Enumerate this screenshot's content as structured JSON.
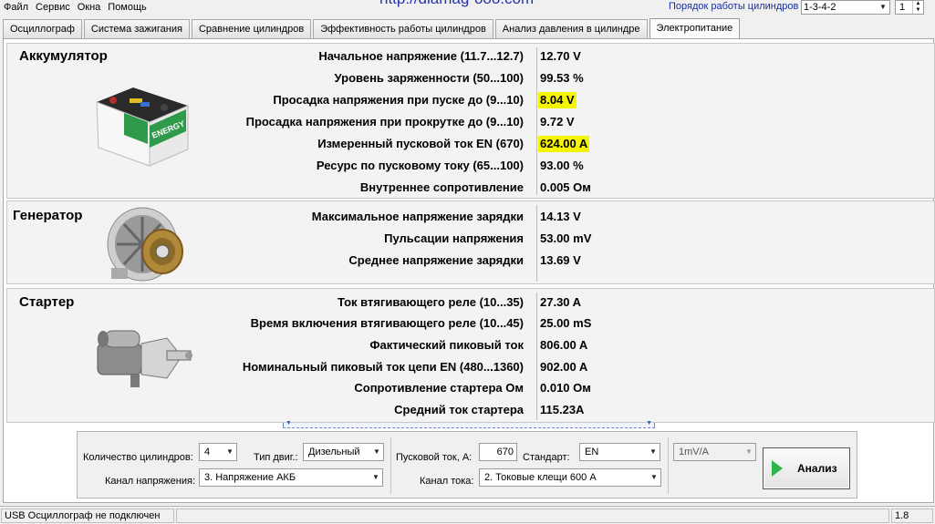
{
  "menu": [
    "Файл",
    "Сервис",
    "Окна",
    "Помощь"
  ],
  "url_text": "http://diamag-ooo.com",
  "cylinder_order": {
    "label": "Порядок работы цилиндров",
    "value": "1-3-4-2",
    "spin_value": "1"
  },
  "tabs": [
    "Осциллограф",
    "Система зажигания",
    "Сравнение цилиндров",
    "Эффективность работы цилиндров",
    "Анализ давления в цилиндре",
    "Электропитание"
  ],
  "active_tab": "Электропитание",
  "battery": {
    "title": "Аккумулятор",
    "image_text": "ENERGY",
    "rows": [
      {
        "label": "Начальное напряжение (11.7...12.7)",
        "value": "12.70 V",
        "highlight": false
      },
      {
        "label": "Уровень заряженности (50...100)",
        "value": "99.53 %",
        "highlight": false
      },
      {
        "label": "Просадка напряжения при пуске до (9...10)",
        "value": "8.04 V",
        "highlight": true
      },
      {
        "label": "Просадка напряжения при прокрутке до  (9...10)",
        "value": "9.72 V",
        "highlight": false
      },
      {
        "label": "Измеренный пусковой ток  EN (670)",
        "value": "624.00 A",
        "highlight": true
      },
      {
        "label": "Ресурс по пусковому току (65...100)",
        "value": "93.00 %",
        "highlight": false
      },
      {
        "label": "Внутреннее сопротивление",
        "value": "0.005 Ом",
        "highlight": false
      }
    ]
  },
  "generator": {
    "title": "Генератор",
    "rows": [
      {
        "label": "Максимальное напряжение зарядки",
        "value": "14.13 V"
      },
      {
        "label": "Пульсации напряжения",
        "value": "53.00 mV"
      },
      {
        "label": "Среднее напряжение зарядки",
        "value": "13.69 V"
      }
    ]
  },
  "starter": {
    "title": "Стартер",
    "rows": [
      {
        "label": "Ток втягивающего реле (10...35)",
        "value": "27.30 A"
      },
      {
        "label": "Время включения втягивающего реле (10...45)",
        "value": "25.00 mS"
      },
      {
        "label": "Фактический пиковый ток",
        "value": "806.00 A"
      },
      {
        "label": "Номинальный пиковый ток цепи EN (480...1360)",
        "value": "902.00 A"
      },
      {
        "label": "Сопротивление стартера Ом",
        "value": "0.010 Ом"
      },
      {
        "label": "Средний ток стартера",
        "value": "115.23A"
      }
    ]
  },
  "controls": {
    "cylinders_label": "Количество цилиндров:",
    "cylinders_value": "4",
    "engine_label": "Тип двиг.:",
    "engine_value": "Дизельный",
    "voltage_channel_label": "Канал напряжения:",
    "voltage_channel_value": "3. Напряжение АКБ",
    "start_current_label": "Пусковой ток, А:",
    "start_current_value": "670",
    "standard_label": "Стандарт:",
    "standard_value": "EN",
    "current_channel_label": "Канал тока:",
    "current_channel_value": "2. Токовые клещи 600 А",
    "scale_value": "1mV/A",
    "analyze_label": "Анализ"
  },
  "status": {
    "connection": "USB Осциллограф не подключен",
    "version": "1.8"
  },
  "colors": {
    "highlight": "#f5f500",
    "play": "#2fb54a",
    "order_label": "#1a2f9a"
  }
}
